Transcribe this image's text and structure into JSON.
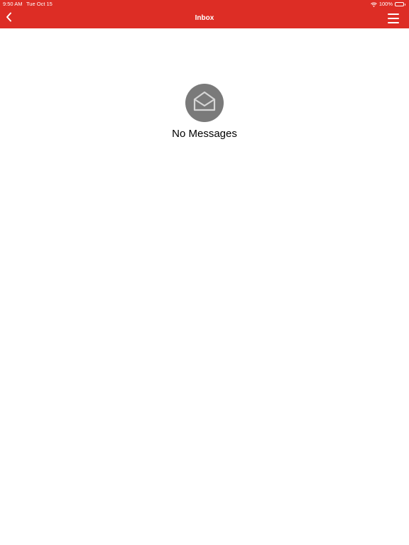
{
  "status_bar": {
    "time": "9:50 AM",
    "date": "Tue Oct 15",
    "battery": "100%",
    "wifi_icon": "wifi-icon",
    "battery_icon": "battery-icon"
  },
  "nav": {
    "title": "Inbox",
    "back_icon": "chevron-left-icon",
    "menu_icon": "hamburger-menu-icon"
  },
  "empty_state": {
    "icon": "open-envelope-icon",
    "message": "No Messages"
  },
  "colors": {
    "header_background": "#dd2d25",
    "icon_circle": "#7a7a7a",
    "page_background": "#ffffff"
  }
}
